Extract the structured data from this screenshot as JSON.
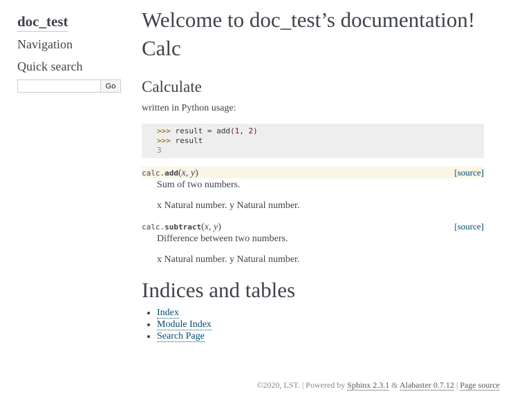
{
  "sidebar": {
    "project_title": "doc_test",
    "navigation_heading": "Navigation",
    "quick_search_heading": "Quick search",
    "search": {
      "value": "",
      "placeholder": "",
      "go_label": "Go"
    }
  },
  "main": {
    "page_title": "Welcome to doc_test’s documentation!",
    "module_title": "Calc",
    "section_title": "Calculate",
    "usage_text": "written in Python usage:",
    "code_lines": [
      {
        "prompt": ">>> ",
        "code_a": "result = add(",
        "num_a": "1",
        "code_b": ", ",
        "num_b": "2",
        "code_c": ")"
      },
      {
        "prompt": ">>> ",
        "code": "result"
      },
      {
        "output": "3"
      }
    ],
    "functions": [
      {
        "prefix": "calc.",
        "name": "add",
        "params": [
          "x",
          "y"
        ],
        "source_label": "[source]",
        "summary": "Sum of two numbers.",
        "params_text": "x Natural number. y Natural number.",
        "highlighted": true
      },
      {
        "prefix": "calc.",
        "name": "subtract",
        "params": [
          "x",
          "y"
        ],
        "source_label": "[source]",
        "summary": "Difference between two numbers.",
        "params_text": "x Natural number. y Natural number.",
        "highlighted": false
      }
    ],
    "indices_title": "Indices and tables",
    "index_links": [
      "Index",
      "Module Index",
      "Search Page"
    ]
  },
  "footer": {
    "copyright": "©2020, LST. | Powered by ",
    "sphinx_link": "Sphinx 2.3.1",
    "amp": " & ",
    "alabaster_link": "Alabaster 0.7.12",
    "sep": " | ",
    "page_source_link": "Page source"
  }
}
